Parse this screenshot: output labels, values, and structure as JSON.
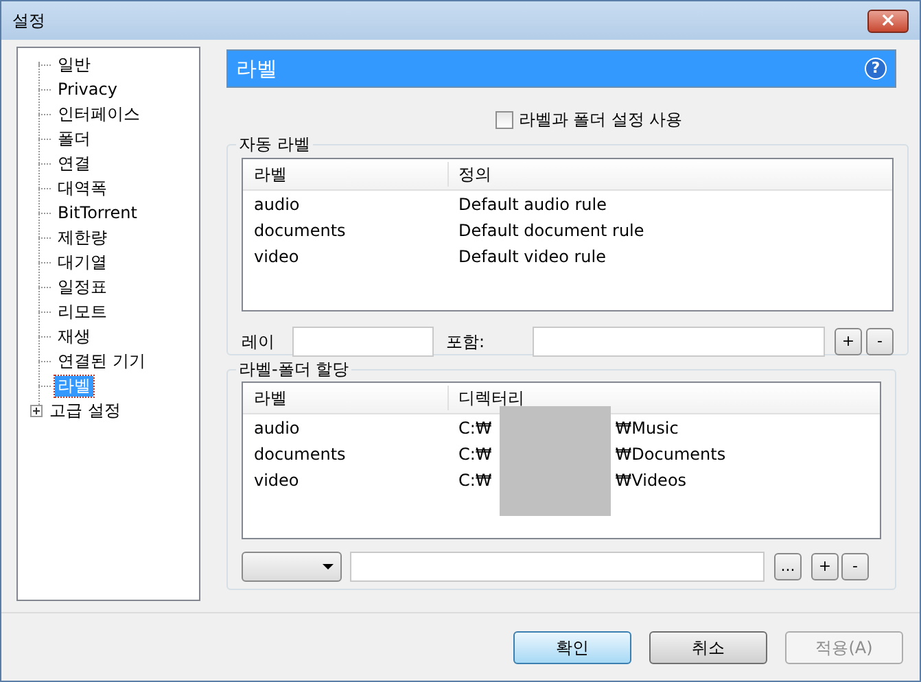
{
  "window": {
    "title": "설정",
    "close": "×"
  },
  "tree": [
    {
      "label": "일반",
      "selected": false
    },
    {
      "label": "Privacy",
      "selected": false
    },
    {
      "label": "인터페이스",
      "selected": false
    },
    {
      "label": "폴더",
      "selected": false
    },
    {
      "label": "연결",
      "selected": false
    },
    {
      "label": "대역폭",
      "selected": false
    },
    {
      "label": "BitTorrent",
      "selected": false
    },
    {
      "label": "제한량",
      "selected": false
    },
    {
      "label": "대기열",
      "selected": false
    },
    {
      "label": "일정표",
      "selected": false
    },
    {
      "label": "리모트",
      "selected": false
    },
    {
      "label": "재생",
      "selected": false
    },
    {
      "label": "연결된 기기",
      "selected": false
    },
    {
      "label": "라벨",
      "selected": true
    },
    {
      "label": "고급 설정",
      "selected": false,
      "expandable": true
    }
  ],
  "header": {
    "title": "라벨",
    "help": "?"
  },
  "enable": {
    "label": "라벨과 폴더 설정 사용",
    "checked": false
  },
  "auto_labels": {
    "title": "자동 라벨",
    "columns": [
      "라벨",
      "정의"
    ],
    "rows": [
      [
        "audio",
        "Default audio rule"
      ],
      [
        "documents",
        "Default document rule"
      ],
      [
        "video",
        "Default video rule"
      ]
    ],
    "label_field": "레이",
    "contains_field": "포함:",
    "add": "+",
    "remove": "-"
  },
  "folder_assign": {
    "title": "라벨-폴더 할당",
    "columns": [
      "라벨",
      "디렉터리"
    ],
    "rows": [
      {
        "label": "audio",
        "path_start": "C:₩",
        "path_end": "₩Music"
      },
      {
        "label": "documents",
        "path_start": "C:₩",
        "path_end": "₩Documents"
      },
      {
        "label": "video",
        "path_start": "C:₩",
        "path_end": "₩Videos"
      }
    ],
    "browse": "...",
    "add": "+",
    "remove": "-"
  },
  "buttons": [
    {
      "label": "확인",
      "disabled": false,
      "default": true
    },
    {
      "label": "취소",
      "disabled": false,
      "default": false
    },
    {
      "label": "적용(A)",
      "disabled": true,
      "default": false
    }
  ]
}
